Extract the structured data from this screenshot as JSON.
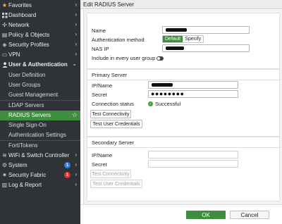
{
  "sidebar": {
    "items": [
      {
        "label": "Favorites",
        "icon": "star-icon"
      },
      {
        "label": "Dashboard",
        "icon": "dashboard-icon"
      },
      {
        "label": "Network",
        "icon": "network-icon"
      },
      {
        "label": "Policy & Objects",
        "icon": "policy-icon"
      },
      {
        "label": "Security Profiles",
        "icon": "shield-icon"
      },
      {
        "label": "VPN",
        "icon": "monitor-icon"
      },
      {
        "label": "User & Authentication",
        "icon": "user-icon"
      }
    ],
    "sub_items": [
      {
        "label": "User Definition"
      },
      {
        "label": "User Groups"
      },
      {
        "label": "Guest Management"
      },
      {
        "label": "LDAP Servers"
      },
      {
        "label": "RADIUS Servers"
      },
      {
        "label": "Single Sign-On"
      },
      {
        "label": "Authentication Settings"
      },
      {
        "label": "FortiTokens"
      }
    ],
    "bottom_items": [
      {
        "label": "WiFi & Switch Controller",
        "icon": "wifi-icon"
      },
      {
        "label": "System",
        "icon": "gear-icon",
        "badge": "1",
        "badge_color": "#2f7fd6"
      },
      {
        "label": "Security Fabric",
        "icon": "fabric-icon",
        "badge": "1",
        "badge_color": "#d9352c"
      },
      {
        "label": "Log & Report",
        "icon": "report-icon"
      }
    ]
  },
  "header": {
    "title": "Edit RADIUS Server"
  },
  "form": {
    "name_label": "Name",
    "auth_method_label": "Authentication method",
    "auth_method_options": [
      "Default",
      "Specify"
    ],
    "auth_method_selected": "Default",
    "nas_ip_label": "NAS IP",
    "include_label": "Include in every user group",
    "primary": {
      "title": "Primary Server",
      "ip_label": "IP/Name",
      "secret_label": "Secret",
      "secret_value": "●●●●●●●●",
      "status_label": "Connection status",
      "status_value": "Successful",
      "test_connectivity": "Test Connectivity",
      "test_credentials": "Test User Credentials"
    },
    "secondary": {
      "title": "Secondary Server",
      "ip_label": "IP/Name",
      "secret_label": "Secret",
      "test_connectivity": "Test Connectivity",
      "test_credentials": "Test User Credentials"
    }
  },
  "footer": {
    "ok_label": "OK",
    "cancel_label": "Cancel"
  },
  "colors": {
    "sidebar_bg": "#2f3337",
    "accent_green": "#3f8e3f"
  }
}
